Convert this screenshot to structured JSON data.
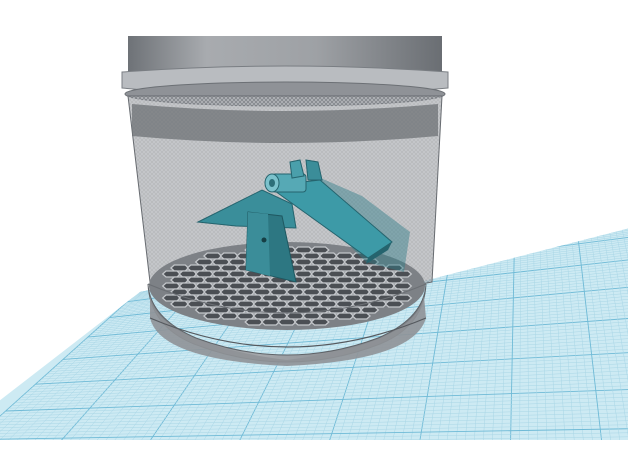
{
  "scene": {
    "colors": {
      "background": "#ffffff",
      "grid_fill": "#cdeaf3",
      "grid_minor": "#a9d6e6",
      "grid_major": "#6fbad6",
      "container_gray": "#8e9196",
      "container_dark": "#5c5f63",
      "container_light": "#c9cbce",
      "mesh": "#b3b6ba",
      "part_teal": "#3a8e9a",
      "part_teal_dark": "#25646e",
      "part_teal_light": "#63b3bf"
    }
  }
}
